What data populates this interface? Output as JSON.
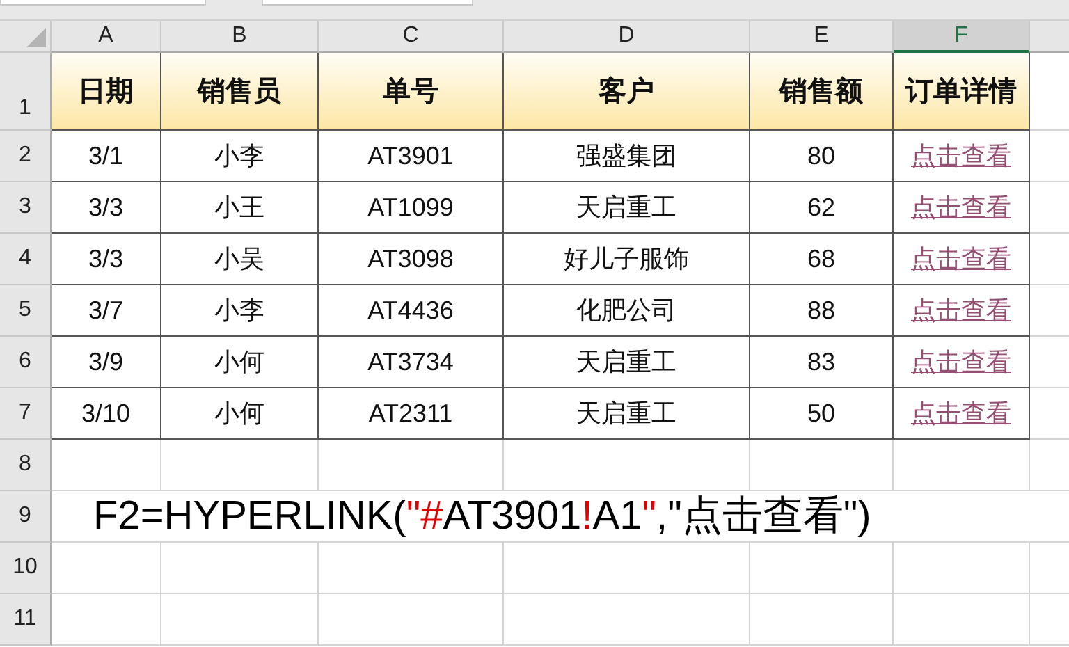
{
  "column_headers": [
    {
      "label": "A",
      "selected": false
    },
    {
      "label": "B",
      "selected": false
    },
    {
      "label": "C",
      "selected": false
    },
    {
      "label": "D",
      "selected": false
    },
    {
      "label": "E",
      "selected": false
    },
    {
      "label": "F",
      "selected": true
    }
  ],
  "row_numbers": [
    "1",
    "2",
    "3",
    "4",
    "5",
    "6",
    "7",
    "8",
    "9",
    "10",
    "11"
  ],
  "table": {
    "columns": [
      {
        "label": "日期",
        "kind": "text"
      },
      {
        "label": "销售员",
        "kind": "text"
      },
      {
        "label": "单号",
        "kind": "text"
      },
      {
        "label": "客户",
        "kind": "text"
      },
      {
        "label": "销售额",
        "kind": "text"
      },
      {
        "label": "订单详情",
        "kind": "link"
      }
    ],
    "rows": [
      [
        "3/1",
        "小李",
        "AT3901",
        "强盛集团",
        "80",
        "点击查看"
      ],
      [
        "3/3",
        "小王",
        "AT1099",
        "天启重工",
        "62",
        "点击查看"
      ],
      [
        "3/3",
        "小吴",
        "AT3098",
        "好儿子服饰",
        "68",
        "点击查看"
      ],
      [
        "3/7",
        "小李",
        "AT4436",
        "化肥公司",
        "88",
        "点击查看"
      ],
      [
        "3/9",
        "小何",
        "AT3734",
        "天启重工",
        "83",
        "点击查看"
      ],
      [
        "3/10",
        "小何",
        "AT2311",
        "天启重工",
        "50",
        "点击查看"
      ]
    ]
  },
  "formula": {
    "segments": [
      {
        "text": "F2=HYPERLINK(",
        "color": "#000000"
      },
      {
        "text": "\"#",
        "color": "#e00000"
      },
      {
        "text": "AT3901",
        "color": "#000000"
      },
      {
        "text": "!",
        "color": "#e00000"
      },
      {
        "text": "A1",
        "color": "#000000"
      },
      {
        "text": "\"",
        "color": "#e00000"
      },
      {
        "text": ",\"点击查看\")",
        "color": "#000000"
      }
    ]
  }
}
